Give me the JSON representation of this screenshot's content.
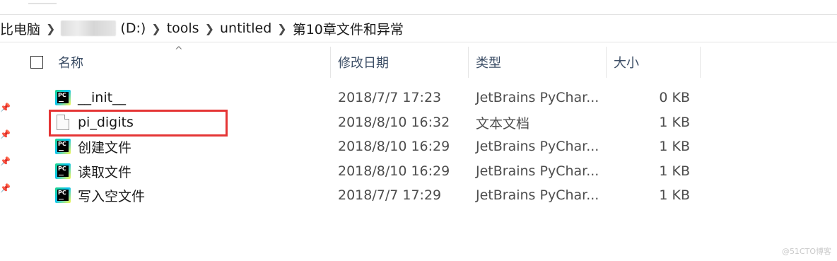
{
  "address": {
    "crumb_partial": "比电脑",
    "drive": "(D:)",
    "folders": [
      "tools",
      "untitled",
      "第10章文件和异常"
    ]
  },
  "columns": {
    "sort_indicator": "^",
    "name": "名称",
    "modified": "修改日期",
    "type": "类型",
    "size": "大小"
  },
  "files": [
    {
      "name": "__init__",
      "icon": "pycharm-file-icon",
      "modified": "2018/7/7 17:23",
      "type": "JetBrains PyChar...",
      "size": "0 KB"
    },
    {
      "name": "pi_digits",
      "icon": "text-file-icon",
      "modified": "2018/8/10 16:32",
      "type": "文本文档",
      "size": "1 KB"
    },
    {
      "name": "创建文件",
      "icon": "pycharm-file-icon",
      "modified": "2018/8/10 16:29",
      "type": "JetBrains PyChar...",
      "size": "1 KB"
    },
    {
      "name": "读取文件",
      "icon": "pycharm-file-icon",
      "modified": "2018/8/10 16:29",
      "type": "JetBrains PyChar...",
      "size": "1 KB"
    },
    {
      "name": "写入空文件",
      "icon": "pycharm-file-icon",
      "modified": "2018/7/7 17:29",
      "type": "JetBrains PyChar...",
      "size": "1 KB"
    }
  ],
  "highlight_color": "#e53535",
  "watermark": "@51CTO博客"
}
